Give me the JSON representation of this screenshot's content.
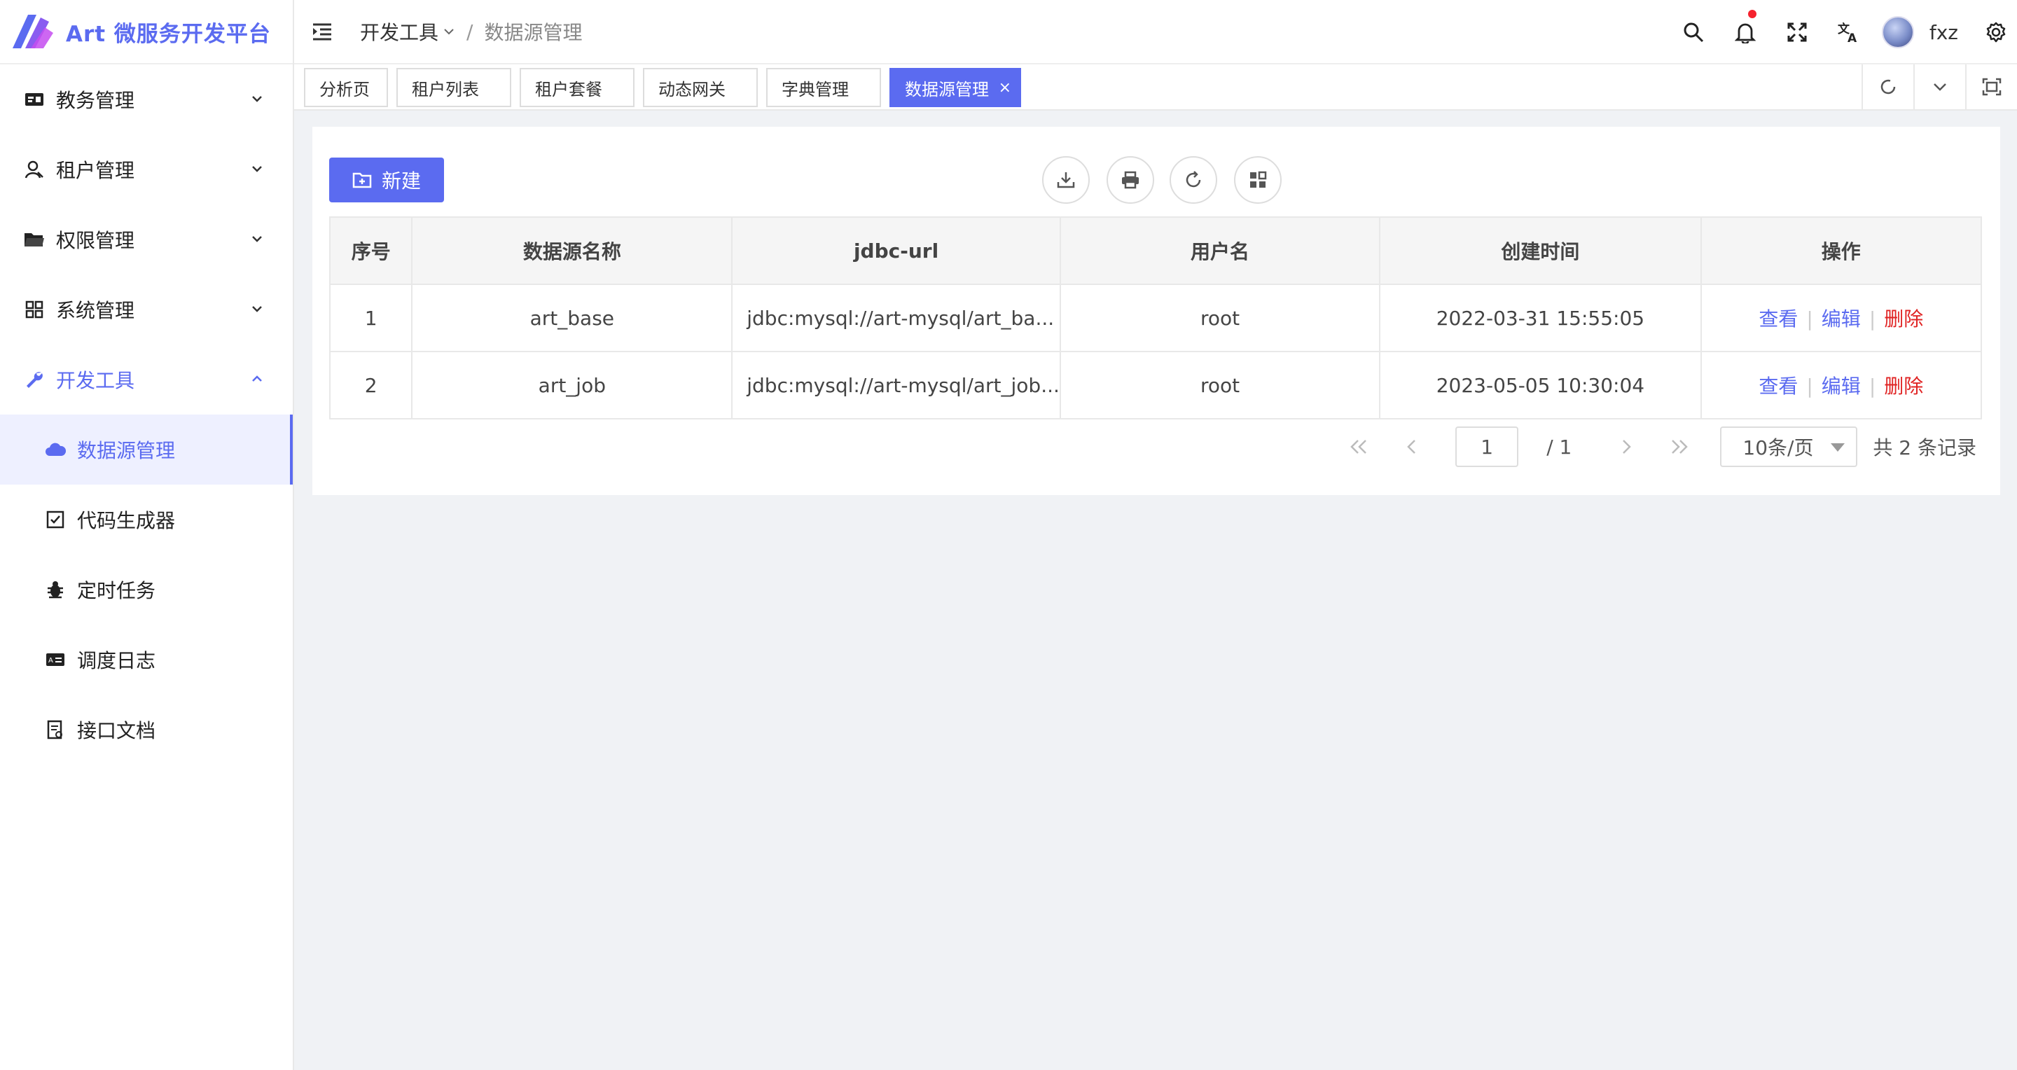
{
  "app": {
    "title": "Art 微服务开发平台"
  },
  "sidebar": {
    "items": [
      {
        "label": "教务管理",
        "icon": "id-card-icon"
      },
      {
        "label": "租户管理",
        "icon": "user-icon"
      },
      {
        "label": "权限管理",
        "icon": "folder-icon"
      },
      {
        "label": "系统管理",
        "icon": "grid-icon"
      },
      {
        "label": "开发工具",
        "icon": "wrench-icon",
        "open": true
      }
    ],
    "subitems": [
      {
        "label": "数据源管理",
        "icon": "cloud-icon",
        "active": true
      },
      {
        "label": "代码生成器",
        "icon": "checkbox-icon"
      },
      {
        "label": "定时任务",
        "icon": "bug-icon"
      },
      {
        "label": "调度日志",
        "icon": "log-icon"
      },
      {
        "label": "接口文档",
        "icon": "document-icon"
      }
    ]
  },
  "header": {
    "breadcrumb": [
      "开发工具",
      "数据源管理"
    ],
    "separator": "/",
    "username": "fxz"
  },
  "tabs": [
    {
      "label": "分析页"
    },
    {
      "label": "租户列表"
    },
    {
      "label": "租户套餐"
    },
    {
      "label": "动态网关"
    },
    {
      "label": "字典管理"
    },
    {
      "label": "数据源管理",
      "active": true,
      "close": "×"
    }
  ],
  "toolbar": {
    "new_label": "新建"
  },
  "table": {
    "columns": [
      "序号",
      "数据源名称",
      "jdbc-url",
      "用户名",
      "创建时间",
      "操作"
    ],
    "rows": [
      {
        "index": "1",
        "name": "art_base",
        "url": "jdbc:mysql://art-mysql/art_ba...",
        "username": "root",
        "created": "2022-03-31 15:55:05"
      },
      {
        "index": "2",
        "name": "art_job",
        "url": "jdbc:mysql://art-mysql/art_job...",
        "username": "root",
        "created": "2023-05-05 10:30:04"
      }
    ],
    "actions": {
      "view": "查看",
      "edit": "编辑",
      "delete": "删除"
    }
  },
  "pagination": {
    "current": "1",
    "total_pages": "/ 1",
    "page_size": "10条/页",
    "total": "共 2 条记录"
  },
  "colors": {
    "accent": "#5b6bf0",
    "danger": "#e02424",
    "notification": "#f5222d"
  }
}
